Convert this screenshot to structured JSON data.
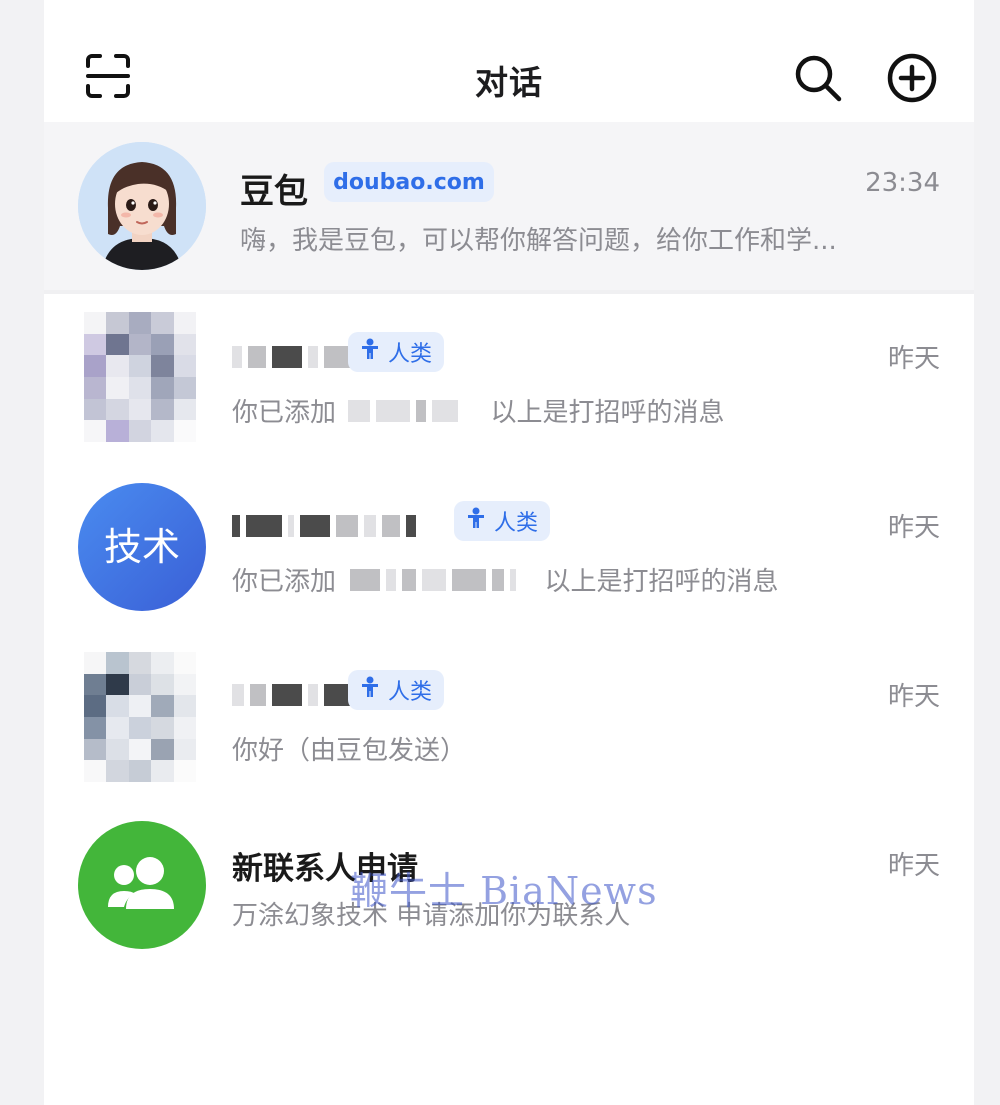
{
  "header": {
    "title": "对话",
    "icons": [
      "scan-icon",
      "search-icon",
      "add-circle-icon"
    ]
  },
  "pinned": {
    "name": "豆包",
    "tag": "doubao.com",
    "time": "23:34",
    "preview": "嗨，我是豆包，可以帮你解答问题，给你工作和学..."
  },
  "chats": [
    {
      "tag": "人类",
      "time": "昨天",
      "preview_start": "你已添加",
      "preview_end": "以上是打招呼的消息"
    },
    {
      "avatar_text": "技术",
      "tag": "人类",
      "time": "昨天",
      "preview_start": "你已添加",
      "preview_end": "以上是打招呼的消息"
    },
    {
      "tag": "人类",
      "time": "昨天",
      "preview": "你好（由豆包发送）"
    },
    {
      "name": "新联系人申请",
      "time": "昨天",
      "preview": "万涂幻象技术 申请添加你为联系人"
    }
  ],
  "watermark": "鞭牛士 BiaNews",
  "colors": {
    "accent_tag_bg": "#e6eefc",
    "accent_tag_text": "#2f6ee8",
    "tech_avatar": "#3d6fe0",
    "new_contact_avatar": "#43b63a"
  }
}
